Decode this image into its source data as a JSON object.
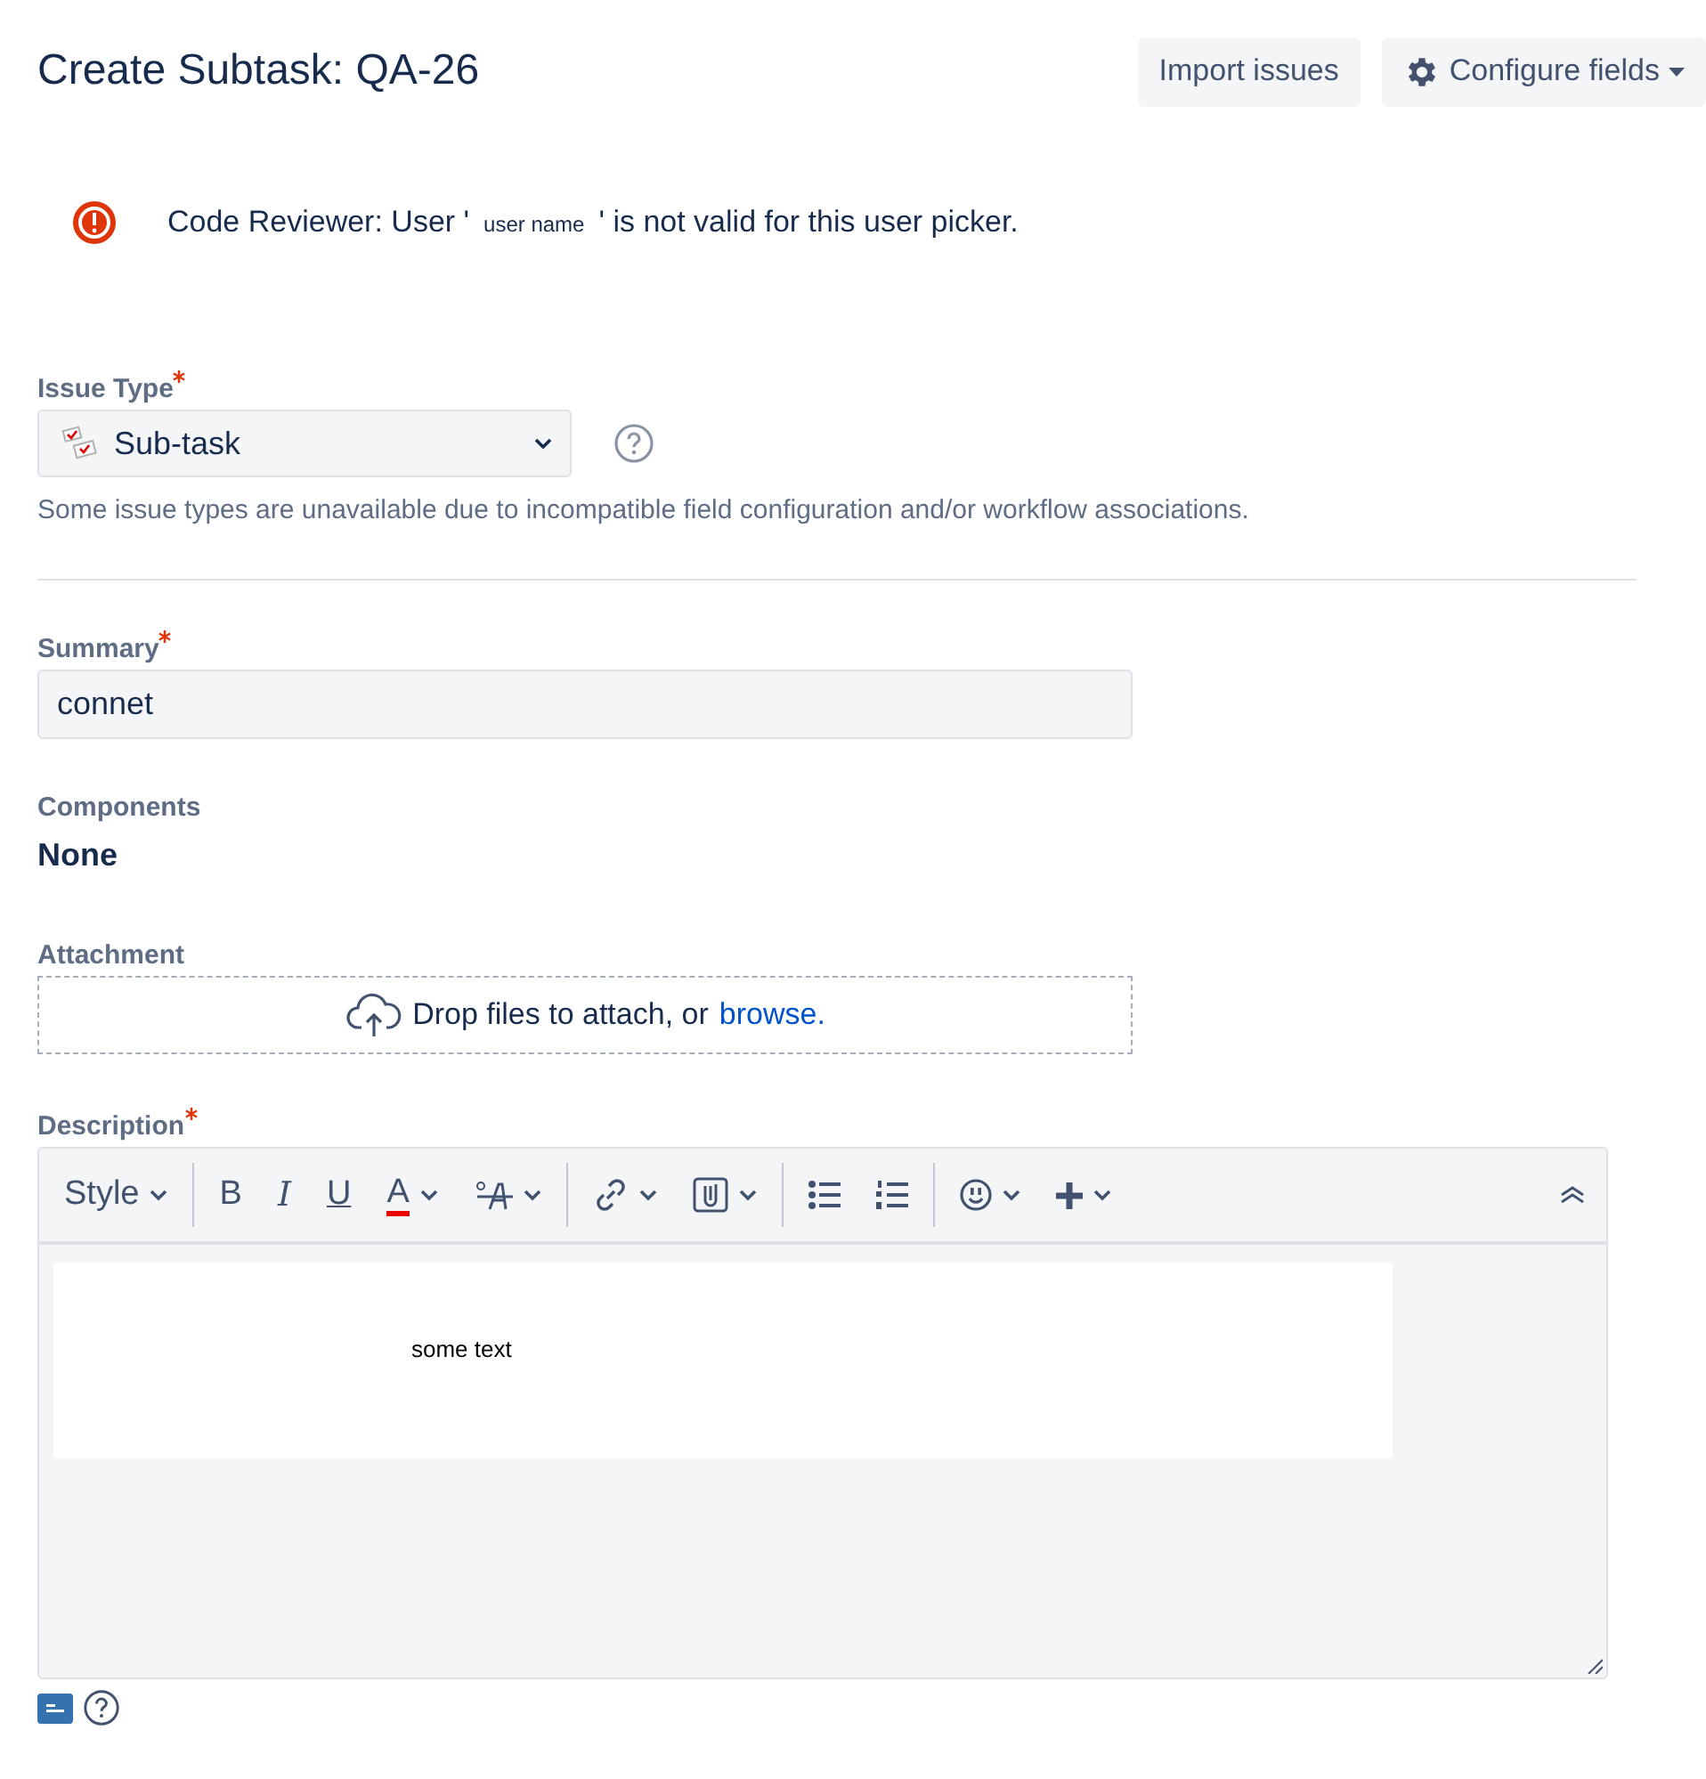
{
  "header": {
    "title": "Create Subtask: QA-26",
    "buttons": [
      {
        "label": "Import issues",
        "kind": "plain"
      },
      {
        "label": "Configure fields",
        "kind": "settings"
      }
    ]
  },
  "error": {
    "before": "Code Reviewer: User '",
    "name": "user name",
    "after": "' is not valid for this user picker."
  },
  "fields": [
    {
      "kind": "select",
      "label": "Issue Type",
      "required": true,
      "value": "Sub-task",
      "help": "Some issue types are unavailable due to incompatible field configuration and/or workflow associations."
    },
    {
      "kind": "text",
      "label": "Summary",
      "required": true,
      "value": "connet"
    },
    {
      "kind": "static",
      "label": "Components",
      "required": false,
      "value": "None"
    },
    {
      "kind": "attachment",
      "label": "Attachment",
      "required": false,
      "text": "Drop files to attach, or",
      "link": "browse."
    },
    {
      "kind": "editor",
      "label": "Description",
      "required": true,
      "style": "Style",
      "bold": "B",
      "italic": "I",
      "underline": "U",
      "text_color": "A",
      "content": "some text"
    }
  ]
}
